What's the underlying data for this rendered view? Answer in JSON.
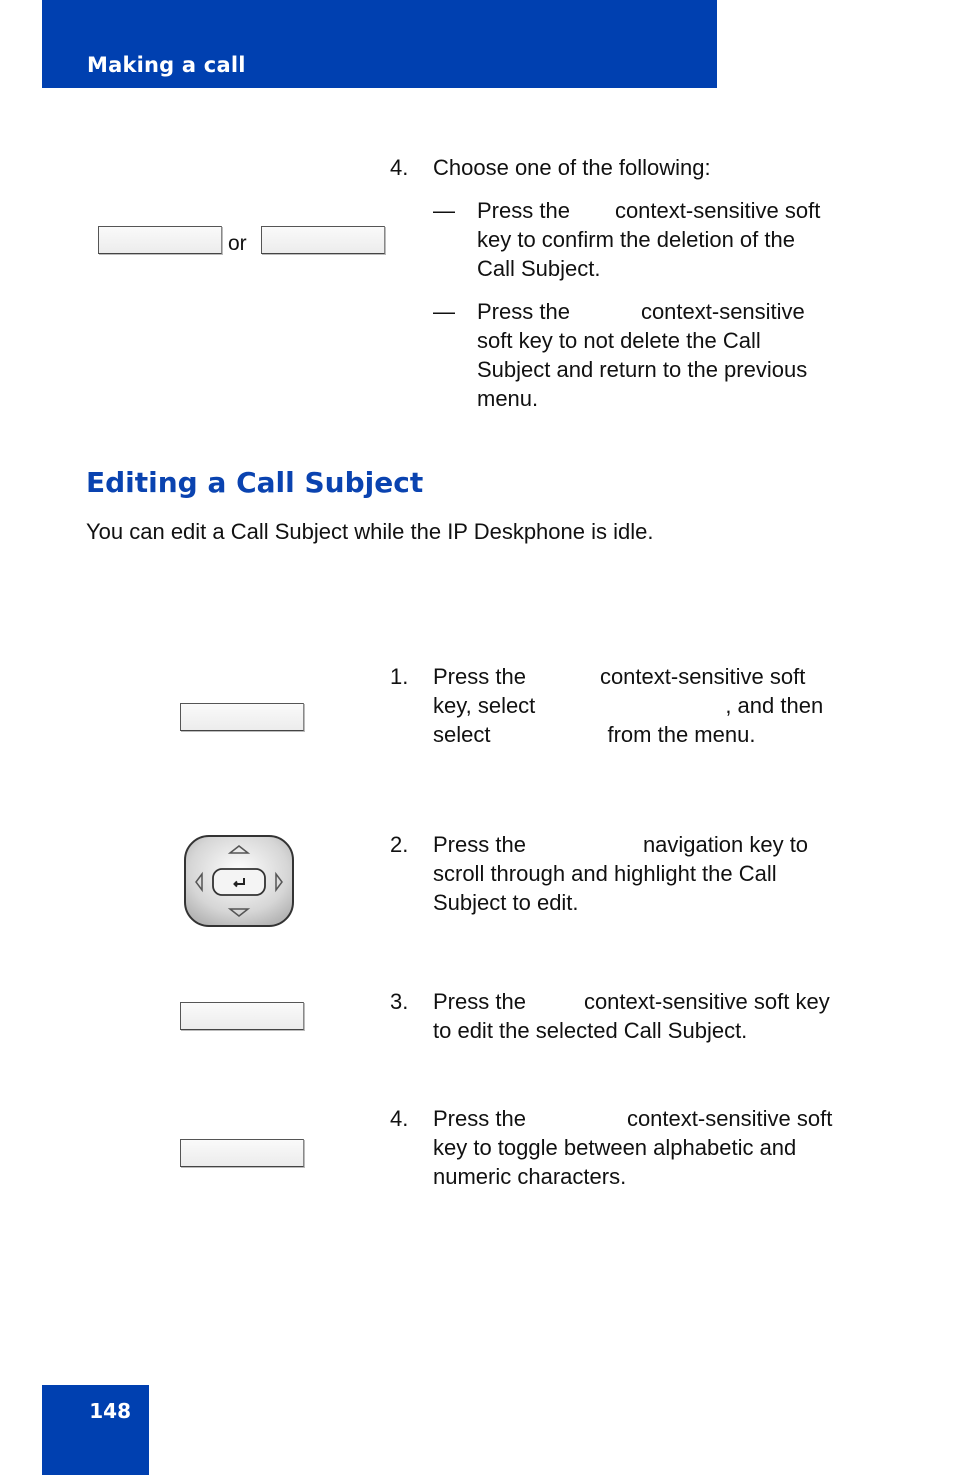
{
  "header": {
    "title": "Making a call"
  },
  "top_step": {
    "number": "4.",
    "text": "Choose one of the following:",
    "or_label": "or",
    "options": [
      {
        "dash": "—",
        "line1a": "Press the",
        "line1b": "context-sensitive soft",
        "rest": [
          "key to confirm the deletion of the",
          "Call Subject."
        ]
      },
      {
        "dash": "—",
        "line1a": "Press the",
        "line1b": "context-sensitive",
        "rest": [
          "soft key to not delete the Call",
          "Subject and return to the previous",
          "menu."
        ]
      }
    ]
  },
  "section": {
    "title": "Editing a Call Subject",
    "intro": "You can edit a Call Subject while the IP Deskphone is idle."
  },
  "steps": [
    {
      "number": "1.",
      "line1a": "Press the",
      "line1b": "context-sensitive soft",
      "line2a": "key, select",
      "line2b": ", and then",
      "line3a": "select",
      "line3b": "from the menu."
    },
    {
      "number": "2.",
      "line1a": "Press the",
      "line1b": "navigation key to",
      "rest": [
        "scroll through and highlight the Call",
        "Subject to edit."
      ]
    },
    {
      "number": "3.",
      "line1a": "Press the",
      "line1b": "context-sensitive soft key",
      "rest": [
        "to edit the selected Call Subject."
      ]
    },
    {
      "number": "4.",
      "line1a": "Press the",
      "line1b": "context-sensitive soft",
      "rest": [
        "key to toggle between alphabetic and",
        "numeric characters."
      ]
    }
  ],
  "footer": {
    "page_number": "148"
  },
  "colors": {
    "brand_blue": "#0040b0",
    "heading_blue": "#0a43b0"
  }
}
